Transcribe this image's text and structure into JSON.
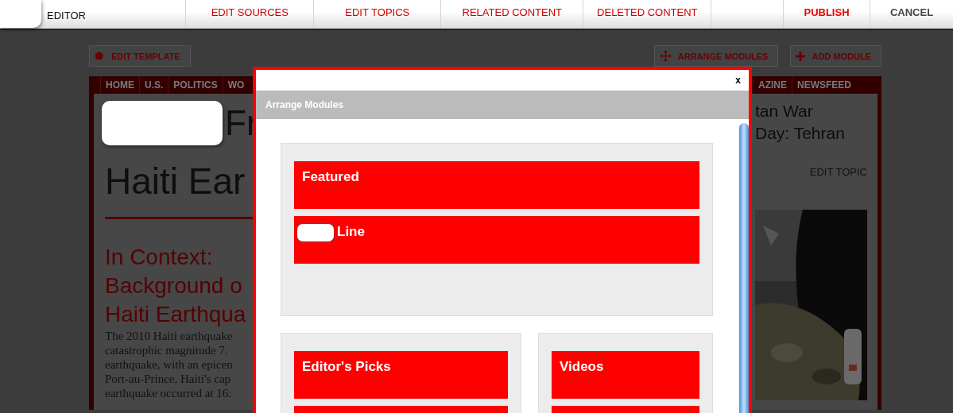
{
  "toolbar": {
    "title": "EDITOR",
    "tabs": [
      {
        "label": "EDIT SOURCES"
      },
      {
        "label": "EDIT TOPICS"
      },
      {
        "label": "RELATED CONTENT"
      },
      {
        "label": "DELETED CONTENT"
      }
    ],
    "publish": "PUBLISH",
    "cancel": "CANCEL"
  },
  "page": {
    "actions": [
      {
        "label": "EDIT TEMPLATE",
        "kind": "gear"
      },
      {
        "label": "ARRANGE MODULES",
        "kind": "move"
      },
      {
        "label": "ADD MODULE",
        "kind": "plus"
      }
    ],
    "nav_left": [
      "HOME",
      "U.S.",
      "POLITICS",
      "WO"
    ],
    "nav_right": [
      "AZINE",
      "NEWSFEED"
    ],
    "title_fragment": "Fr",
    "headline": "Haiti Ear",
    "context_heading": "In Context:\nBackground o\nHaiti Earthqua",
    "body": "The 2010 Haiti earthquake\ncatastrophic magnitude 7.\nearthquake, with an epicen\nPort-au-Prince, Haiti's cap\nearthquake occurred at 16:",
    "related": [
      "tan War",
      "Day: Tehran"
    ],
    "edit_topic": "EDIT TOPIC"
  },
  "modal": {
    "close": "x",
    "title": "Arrange Modules",
    "sections": [
      {
        "kind": "full",
        "modules": [
          {
            "label": "Featured",
            "redacted": false
          },
          {
            "label": "Line",
            "redacted": true
          }
        ]
      },
      {
        "kind": "wide",
        "modules": [
          {
            "label": "Editor's Picks",
            "redacted": false
          },
          {
            "redacted": false
          }
        ]
      },
      {
        "kind": "narrow",
        "modules": [
          {
            "label": "Videos",
            "redacted": false
          },
          {
            "redacted": false
          }
        ]
      }
    ]
  }
}
